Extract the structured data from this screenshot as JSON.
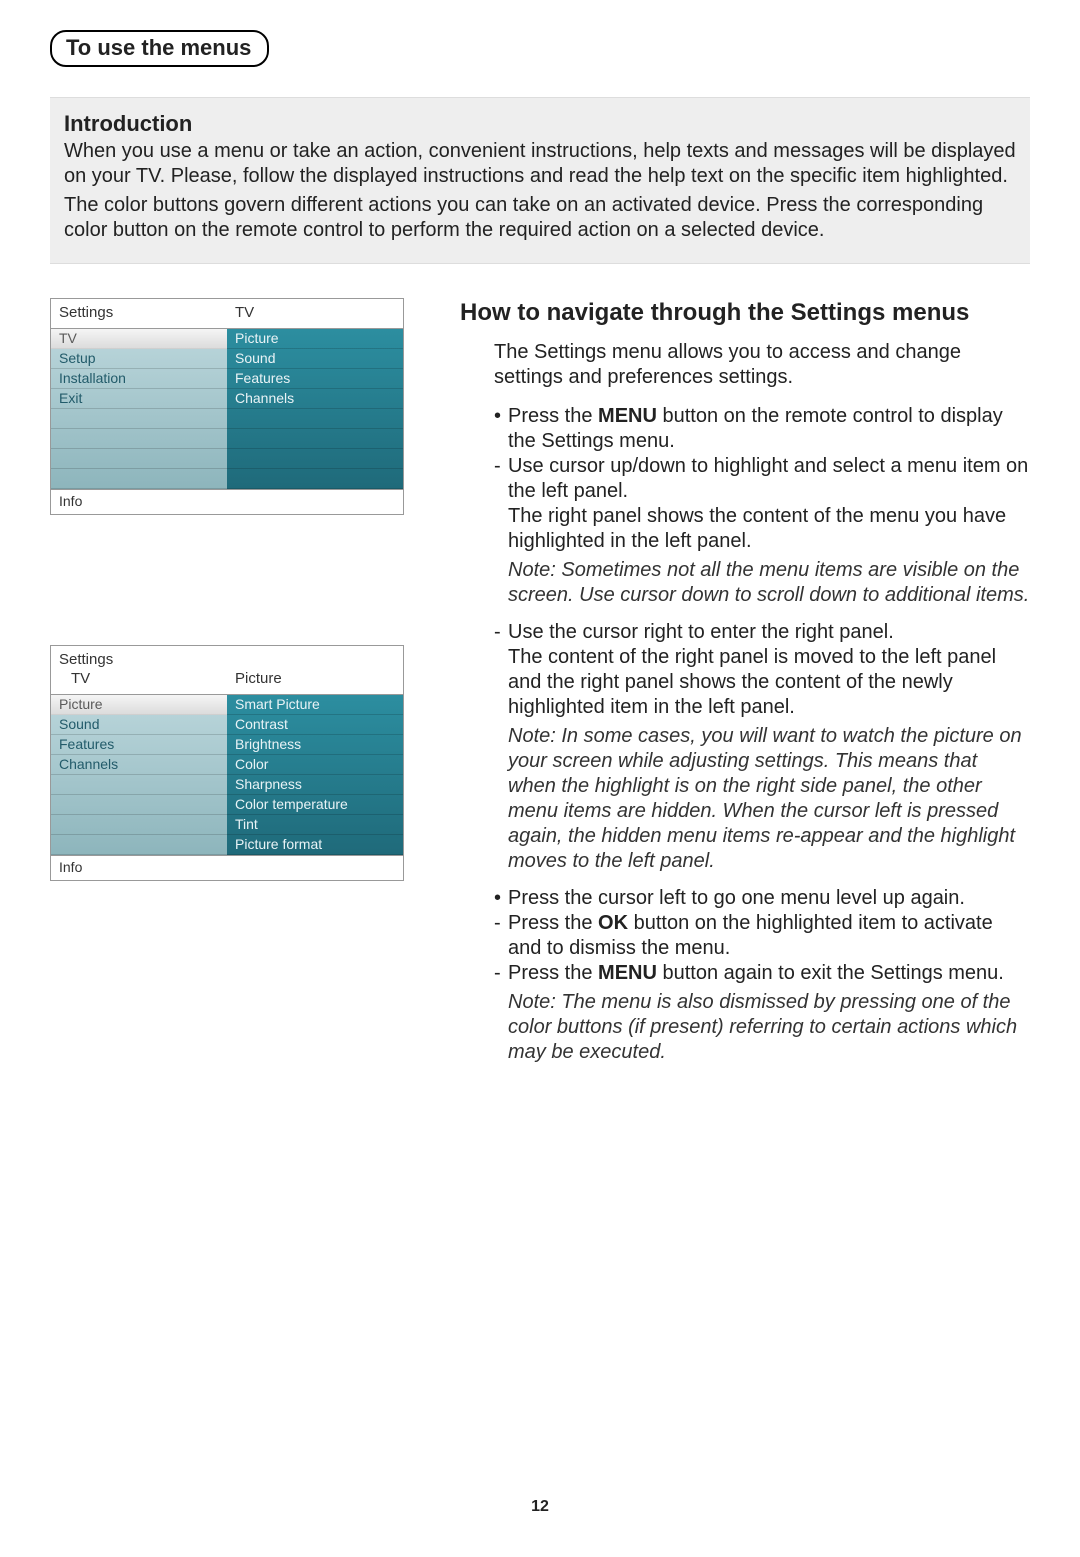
{
  "header": {
    "pill": "To use the menus"
  },
  "intro": {
    "title": "Introduction",
    "p1": "When you use a menu or take an action, convenient instructions, help texts and messages will be displayed on your TV. Please, follow the displayed instructions and read the help text on the specific item highlighted.",
    "p2": "The color buttons govern different actions you can take on an activated device. Press the corresponding color button on the remote control to perform the required action on a selected device."
  },
  "menu1": {
    "heading_left": "Settings",
    "heading_right": "TV",
    "left_items": [
      "TV",
      "Setup",
      "Installation",
      "Exit"
    ],
    "left_selected_index": 0,
    "right_items": [
      "Picture",
      "Sound",
      "Features",
      "Channels"
    ],
    "footer": "Info"
  },
  "menu2": {
    "heading_left": "Settings",
    "heading_right": "",
    "sub_left": "TV",
    "sub_right": "Picture",
    "left_items": [
      "Picture",
      "Sound",
      "Features",
      "Channels"
    ],
    "left_selected_index": 0,
    "right_items": [
      "Smart Picture",
      "Contrast",
      "Brightness",
      "Color",
      "Sharpness",
      "Color temperature",
      "Tint",
      "Picture format"
    ],
    "footer": "Info"
  },
  "right": {
    "title": "How to navigate through the Settings menus",
    "intro": "The Settings menu allows you to access and change settings and preferences settings.",
    "step1_a": "Press the ",
    "step1_menu": "MENU",
    "step1_b": " button on the remote control to display the Settings menu.",
    "step1_sub1": "Use cursor up/down to highlight and select a menu item on the left panel.",
    "step1_sub2": "The right panel shows the content of the  menu you have highlighted in the left panel.",
    "note1": "Note: Sometimes not all the menu items are visible on the screen. Use cursor down to scroll down to additional items.",
    "step2_sub1": "Use the cursor right to enter the right panel.",
    "step2_sub2": "The content of the right panel is moved to the left panel and the right panel shows the content of the newly highlighted item in the left panel.",
    "note2": "Note: In some cases, you will want to watch the picture on your screen while adjusting settings. This means that when the highlight is on the right side panel, the other menu items are hidden. When the cursor left is pressed again, the hidden menu items re-appear and the highlight moves to the left panel.",
    "step3": "Press the cursor left to go one menu level up again.",
    "step3_sub1_a": "Press the ",
    "step3_sub1_ok": "OK",
    "step3_sub1_b": " button on the highlighted item to activate and to dismiss the menu.",
    "step3_sub2_a": "Press the ",
    "step3_sub2_menu": "MENU",
    "step3_sub2_b": " button again to exit the Settings menu.",
    "note3": "Note: The menu is also dismissed by pressing one of the color buttons (if present) referring to certain actions which may be executed."
  },
  "page_number": "12"
}
